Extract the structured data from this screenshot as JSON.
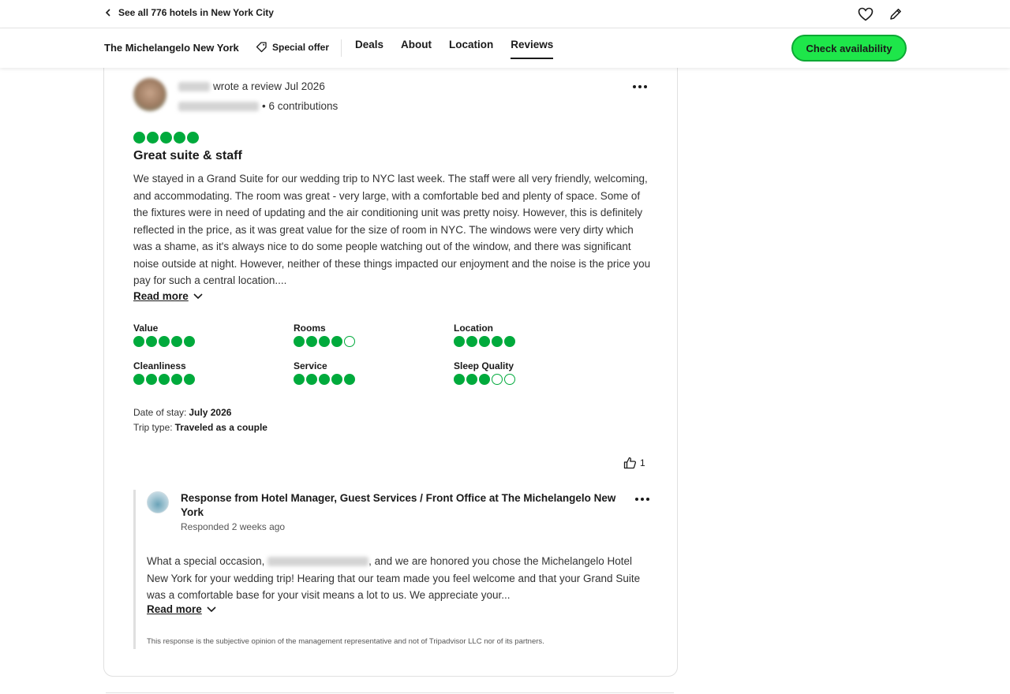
{
  "topbar": {
    "back_label": "See all 776 hotels in New York City"
  },
  "nav": {
    "hotel_name": "The Michelangelo New York",
    "special_offer": "Special offer",
    "tabs": [
      {
        "label": "Deals",
        "active": false
      },
      {
        "label": "About",
        "active": false
      },
      {
        "label": "Location",
        "active": false
      },
      {
        "label": "Reviews",
        "active": true
      }
    ],
    "cta": "Check availability"
  },
  "review": {
    "wrote_text": "wrote a review Jul 2026",
    "contributions": "• 6 contributions",
    "overall_rating": 5,
    "title": "Great suite & staff",
    "text": "We stayed in a Grand Suite for our wedding trip to NYC last week. The staff were all very friendly, welcoming, and accommodating. The room was great - very large, with a comfortable bed and plenty of space. Some of the fixtures were in need of updating and the air conditioning unit was pretty noisy. However, this is definitely reflected in the price, as it was great value for the size of room in NYC. The windows were very dirty which was a shame, as it's always nice to do some people watching out of the window, and there was significant noise outside at night. However, neither of these things impacted our enjoyment and the noise is the price you pay for such a central location....",
    "read_more": "Read more",
    "sub_ratings": [
      {
        "label": "Value",
        "rating": 5
      },
      {
        "label": "Rooms",
        "rating": 4
      },
      {
        "label": "Location",
        "rating": 5
      },
      {
        "label": "Cleanliness",
        "rating": 5
      },
      {
        "label": "Service",
        "rating": 5
      },
      {
        "label": "Sleep Quality",
        "rating": 3
      }
    ],
    "date_of_stay_label": "Date of stay:",
    "date_of_stay": "July 2026",
    "trip_type_label": "Trip type:",
    "trip_type": "Traveled as a couple",
    "helpful_count": "1"
  },
  "response": {
    "title": "Response from Hotel Manager, Guest Services / Front Office at The Michelangelo New York",
    "responded": "Responded 2 weeks ago",
    "text_before": "What a special occasion,",
    "text_after": ", and we are honored you chose the Michelangelo Hotel New York for your wedding trip! Hearing that our team made you feel welcome and that your Grand Suite was a comfortable base for your visit means a lot to us. We appreciate your...",
    "read_more": "Read more",
    "disclaimer": "This response is the subjective opinion of the management representative and not of Tripadvisor LLC nor of its partners."
  },
  "colors": {
    "bubble": "#00aa3c",
    "cta": "#1ee64a"
  },
  "icons": [
    "chevron-left-icon",
    "heart-icon",
    "pencil-icon",
    "tag-icon",
    "more-dots-icon",
    "chevron-down-icon",
    "thumbs-up-icon"
  ]
}
